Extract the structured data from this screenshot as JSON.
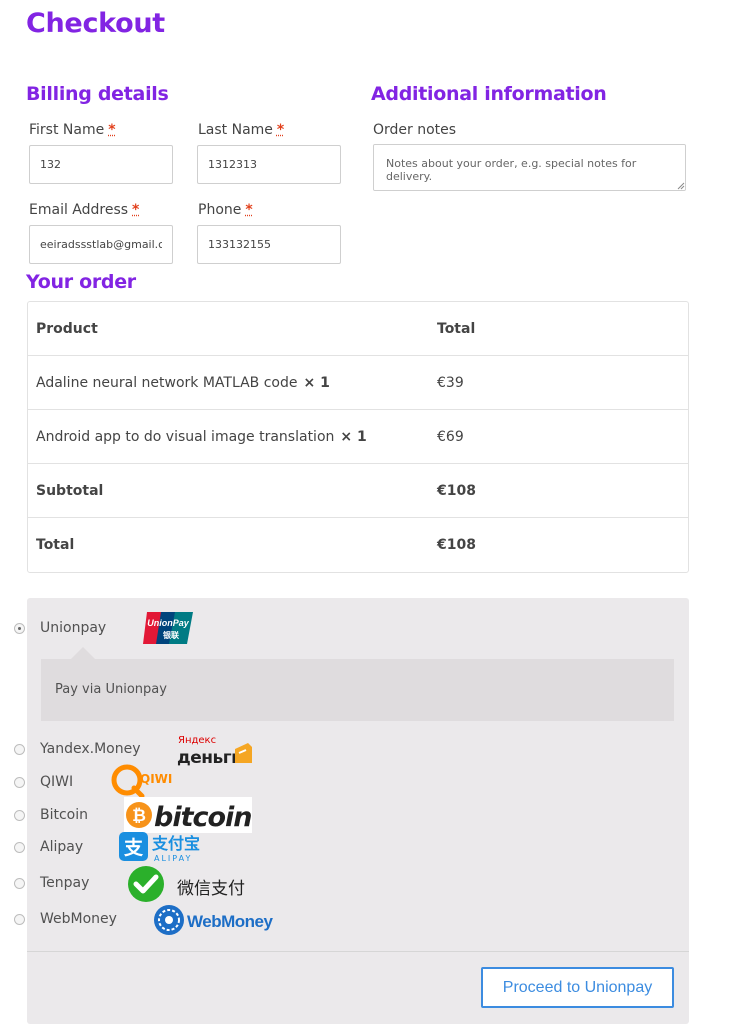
{
  "page": {
    "title": "Checkout"
  },
  "billing": {
    "heading": "Billing details",
    "required_mark": "*",
    "first_name": {
      "label": "First Name",
      "value": "132"
    },
    "last_name": {
      "label": "Last Name",
      "value": "1312313"
    },
    "email": {
      "label": "Email Address",
      "value": "eeiradssstlab@gmail.c"
    },
    "phone": {
      "label": "Phone",
      "value": "133132155"
    }
  },
  "additional": {
    "heading": "Additional information",
    "notes_label": "Order notes",
    "notes_placeholder": "Notes about your order, e.g. special notes for delivery."
  },
  "order": {
    "heading": "Your order",
    "columns": {
      "product": "Product",
      "total": "Total"
    },
    "items": [
      {
        "name": "Adaline neural network MATLAB code",
        "qty": "× 1",
        "total": "€39"
      },
      {
        "name": "Android app to do visual image translation",
        "qty": "× 1",
        "total": "€69"
      }
    ],
    "subtotal": {
      "label": "Subtotal",
      "value": "€108"
    },
    "total": {
      "label": "Total",
      "value": "€108"
    }
  },
  "payment": {
    "selected": "Unionpay",
    "description": "Pay via Unionpay",
    "methods": [
      {
        "label": "Unionpay",
        "icon": "unionpay-logo",
        "logo_text": "UnionPay",
        "logo_sub": "银联"
      },
      {
        "label": "Yandex.Money",
        "icon": "yandex-money-logo",
        "logo_text": "Яндекс",
        "logo_sub": "деньги"
      },
      {
        "label": "QIWI",
        "icon": "qiwi-logo",
        "logo_text": "QIWI"
      },
      {
        "label": "Bitcoin",
        "icon": "bitcoin-logo",
        "logo_text": "bitcoin"
      },
      {
        "label": "Alipay",
        "icon": "alipay-logo",
        "logo_text": "支付宝",
        "logo_sub": "ALIPAY"
      },
      {
        "label": "Tenpay",
        "icon": "tenpay-logo",
        "logo_text": "微信支付"
      },
      {
        "label": "WebMoney",
        "icon": "webmoney-logo",
        "logo_text": "WebMoney"
      }
    ],
    "proceed_label": "Proceed to Unionpay"
  },
  "colors": {
    "accent": "#8224e3",
    "button": "#3c8ce0",
    "required": "#e2401c",
    "payment_bg": "#ebe9eb"
  }
}
